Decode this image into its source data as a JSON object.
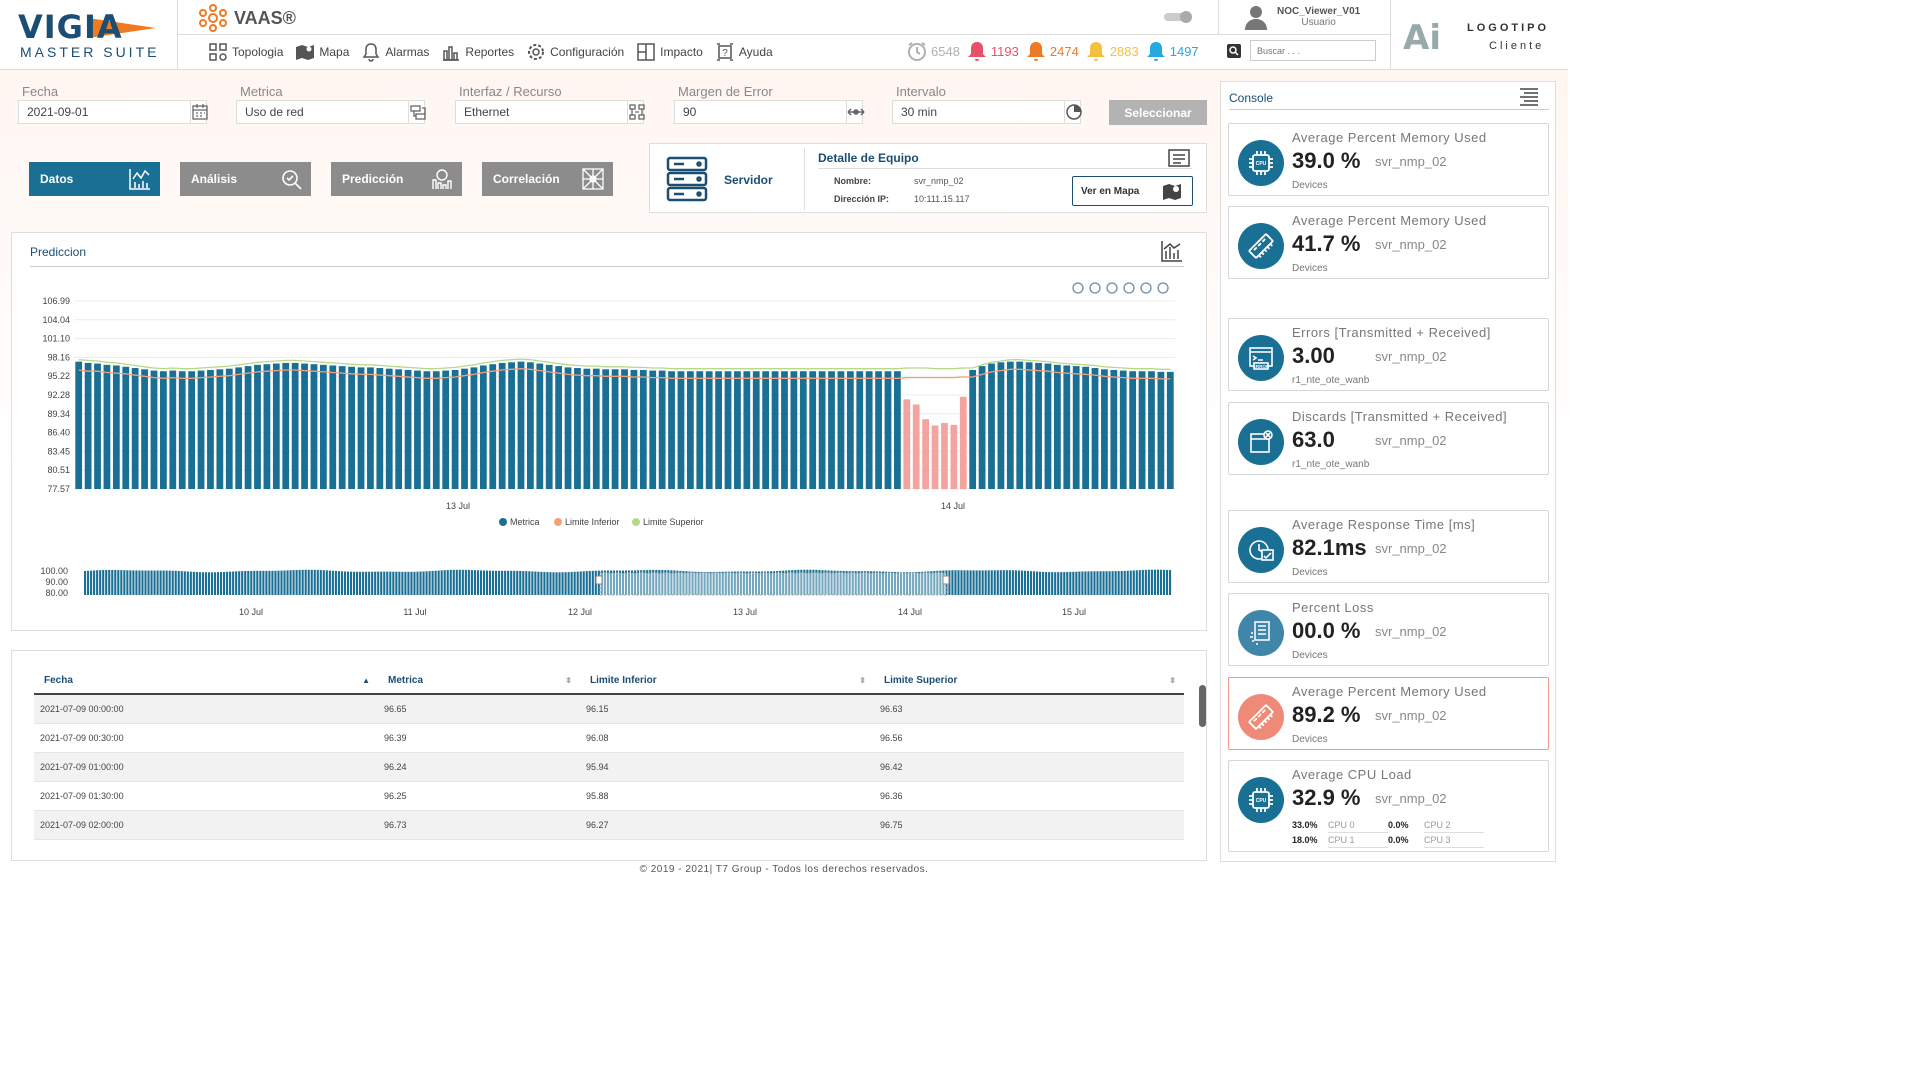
{
  "brand": {
    "main": "VIGIA",
    "sub": "MASTER SUITE",
    "product": "VAAS®"
  },
  "nav": [
    {
      "label": "Topologia",
      "icon": "topology-icon"
    },
    {
      "label": "Mapa",
      "icon": "map-icon"
    },
    {
      "label": "Alarmas",
      "icon": "bell-icon"
    },
    {
      "label": "Reportes",
      "icon": "reports-icon"
    },
    {
      "label": "Configuración",
      "icon": "gear-icon"
    },
    {
      "label": "Impacto",
      "icon": "impact-icon"
    },
    {
      "label": "Ayuda",
      "icon": "help-icon"
    }
  ],
  "user": {
    "name": "NOC_Viewer_V01",
    "role": "Usuario"
  },
  "counters": [
    {
      "value": "6548",
      "color": "#b0b0b0",
      "icon": "clock-icon"
    },
    {
      "value": "1193",
      "color": "#e8506a",
      "icon": "bell-critical-icon"
    },
    {
      "value": "2474",
      "color": "#f07a22",
      "icon": "bell-major-icon"
    },
    {
      "value": "2883",
      "color": "#f5c040",
      "icon": "bell-minor-icon"
    },
    {
      "value": "1497",
      "color": "#26a9e0",
      "icon": "bell-info-icon"
    }
  ],
  "search": {
    "placeholder": "Buscar . . ."
  },
  "client": {
    "logo": "Ai",
    "line1": "LOGOTIPO",
    "line2": "Cliente"
  },
  "filters": {
    "fecha": {
      "label": "Fecha",
      "value": "2021-09-01"
    },
    "metrica": {
      "label": "Metrica",
      "value": "Uso de red"
    },
    "interfaz": {
      "label": "Interfaz / Recurso",
      "value": "Ethernet"
    },
    "margen": {
      "label": "Margen de Error",
      "value": "90"
    },
    "intervalo": {
      "label": "Intervalo",
      "value": "30 min"
    },
    "select_label": "Seleccionar"
  },
  "tabs": [
    {
      "label": "Datos",
      "color": "#1a6f94"
    },
    {
      "label": "Análisis",
      "color": "#8c8c8c"
    },
    {
      "label": "Predicción",
      "color": "#8c8c8c"
    },
    {
      "label": "Correlación",
      "color": "#8c8c8c"
    }
  ],
  "equipo": {
    "type": "Servidor",
    "title": "Detalle de Equipo",
    "nombre_label": "Nombre:",
    "nombre": "svr_nmp_02",
    "ip_label": "Dirección IP:",
    "ip": "10:111.15.117",
    "map_button": "Ver en Mapa"
  },
  "prediction": {
    "title": "Prediccion"
  },
  "chart_data": {
    "type": "bar",
    "yticks": [
      "106.99",
      "104.04",
      "101.10",
      "98.16",
      "95.22",
      "92.28",
      "89.34",
      "86.40",
      "83.45",
      "80.51",
      "77.57"
    ],
    "ylim": [
      77.57,
      106.99
    ],
    "xticks": [
      "13 Jul",
      "14 Jul"
    ],
    "legend": [
      "Metrica",
      "Limite Inferior",
      "Limite Superior"
    ],
    "legend_position": "bottom",
    "colors": {
      "metrica": "#1a6f94",
      "anomaly": "#f4a4a0",
      "inferior": "#f6a07a",
      "superior": "#b7d98a"
    },
    "series": [
      {
        "name": "Metrica",
        "values": [
          97.5,
          97.3,
          97.2,
          97.0,
          96.9,
          96.7,
          96.5,
          96.3,
          96.1,
          96.0,
          96.1,
          96.0,
          96.0,
          96.1,
          96.2,
          96.3,
          96.4,
          96.6,
          96.8,
          97.0,
          97.1,
          97.2,
          97.3,
          97.3,
          97.2,
          97.1,
          97.0,
          96.9,
          96.8,
          96.7,
          96.6,
          96.6,
          96.5,
          96.4,
          96.3,
          96.2,
          96.1,
          96.0,
          96.0,
          96.1,
          96.2,
          96.4,
          96.6,
          96.9,
          97.1,
          97.3,
          97.4,
          97.5,
          97.4,
          97.2,
          97.0,
          96.8,
          96.6,
          96.5,
          96.4,
          96.4,
          96.3,
          96.3,
          96.3,
          96.2,
          96.2,
          96.1,
          96.1,
          96.0,
          96.0,
          96.0,
          96.0,
          96.0,
          96.0,
          96.0,
          96.0,
          96.0,
          96.0,
          96.0,
          96.0,
          96.0,
          96.0,
          96.0,
          96.0,
          96.0,
          96.0,
          96.0,
          96.0,
          96.0,
          96.0,
          96.0,
          96.0,
          96.0,
          91.6,
          90.8,
          88.5,
          87.5,
          87.9,
          87.6,
          92.0,
          96.2,
          96.8,
          97.2,
          97.4,
          97.5,
          97.5,
          97.4,
          97.3,
          97.2,
          97.0,
          96.9,
          96.8,
          96.7,
          96.5,
          96.3,
          96.2,
          96.1,
          96.0,
          96.0,
          96.0,
          95.9,
          95.9
        ]
      },
      {
        "name": "Limite Inferior",
        "values": [
          96.2,
          96.0,
          96.0,
          95.8,
          95.7,
          95.6,
          95.4,
          95.2,
          95.0,
          94.9,
          95.0,
          94.9,
          94.9,
          95.0,
          95.1,
          95.2,
          95.3,
          95.5,
          95.7,
          95.9,
          96.0,
          96.1,
          96.2,
          96.2,
          96.1,
          96.0,
          95.9,
          95.8,
          95.7,
          95.6,
          95.5,
          95.5,
          95.4,
          95.3,
          95.2,
          95.1,
          95.0,
          94.9,
          94.9,
          95.0,
          95.1,
          95.3,
          95.5,
          95.8,
          96.0,
          96.2,
          96.3,
          96.4,
          96.3,
          96.1,
          95.9,
          95.7,
          95.5,
          95.4,
          95.3,
          95.3,
          95.2,
          95.2,
          95.2,
          95.1,
          95.1,
          95.0,
          95.0,
          94.9,
          94.9,
          94.9,
          94.9,
          94.9,
          94.9,
          94.9,
          94.9,
          94.9,
          94.9,
          94.9,
          94.9,
          94.9,
          94.9,
          94.9,
          94.9,
          94.9,
          94.9,
          94.9,
          94.9,
          94.9,
          94.9,
          94.9,
          94.9,
          94.9,
          95.0,
          95.0,
          95.0,
          95.0,
          95.0,
          95.0,
          95.1,
          95.1,
          95.5,
          95.9,
          96.1,
          96.3,
          96.3,
          96.2,
          96.1,
          96.0,
          95.8,
          95.7,
          95.6,
          95.5,
          95.4,
          95.2,
          95.1,
          95.0,
          94.9,
          94.9,
          94.9,
          94.8,
          94.8
        ]
      },
      {
        "name": "Limite Superior",
        "values": [
          97.8,
          97.7,
          97.6,
          97.4,
          97.3,
          97.1,
          96.9,
          96.7,
          96.5,
          96.4,
          96.5,
          96.4,
          96.4,
          96.5,
          96.6,
          96.7,
          96.8,
          97.0,
          97.2,
          97.4,
          97.5,
          97.6,
          97.7,
          97.7,
          97.6,
          97.5,
          97.4,
          97.3,
          97.2,
          97.1,
          97.0,
          97.0,
          96.9,
          96.8,
          96.7,
          96.6,
          96.5,
          96.4,
          96.4,
          96.5,
          96.6,
          96.8,
          97.0,
          97.3,
          97.5,
          97.7,
          97.8,
          97.9,
          97.8,
          97.6,
          97.4,
          97.2,
          97.0,
          96.9,
          96.8,
          96.8,
          96.7,
          96.7,
          96.7,
          96.6,
          96.6,
          96.5,
          96.5,
          96.4,
          96.4,
          96.4,
          96.4,
          96.4,
          96.4,
          96.4,
          96.4,
          96.4,
          96.4,
          96.4,
          96.4,
          96.4,
          96.4,
          96.4,
          96.4,
          96.4,
          96.4,
          96.4,
          96.4,
          96.4,
          96.4,
          96.4,
          96.4,
          96.4,
          96.5,
          96.5,
          96.5,
          96.4,
          96.4,
          96.4,
          96.5,
          96.5,
          97.0,
          97.4,
          97.6,
          97.8,
          97.8,
          97.7,
          97.6,
          97.5,
          97.3,
          97.2,
          97.1,
          97.0,
          96.9,
          96.7,
          96.6,
          96.5,
          96.4,
          96.4,
          96.4,
          96.3,
          96.3
        ]
      }
    ],
    "navigator": {
      "yticks": [
        "100.00",
        "90.00",
        "80.00"
      ],
      "ylim": [
        76,
        101
      ],
      "xticks": [
        "10 Jul",
        "11 Jul",
        "12 Jul",
        "13 Jul",
        "14 Jul",
        "15 Jul"
      ]
    }
  },
  "table": {
    "columns": [
      "Fecha",
      "Metrica",
      "Limite Inferior",
      "Limite Superior"
    ],
    "rows": [
      [
        "2021-07-09 00:00:00",
        "96.65",
        "96.15",
        "96.63"
      ],
      [
        "2021-07-09 00:30:00",
        "96.39",
        "96.08",
        "96.56"
      ],
      [
        "2021-07-09 01:00:00",
        "96.24",
        "95.94",
        "96.42"
      ],
      [
        "2021-07-09 01:30:00",
        "96.25",
        "95.88",
        "96.36"
      ],
      [
        "2021-07-09 02:00:00",
        "96.73",
        "96.27",
        "96.75"
      ]
    ]
  },
  "console": {
    "title": "Console",
    "cards": [
      {
        "title": "Average Percent Memory Used",
        "value": "39.0 %",
        "device": "svr_nmp_02",
        "sub": "Devices",
        "icon": "cpu-icon",
        "alert": false
      },
      {
        "title": "Average Percent Memory Used",
        "value": "41.7 %",
        "device": "svr_nmp_02",
        "sub": "Devices",
        "icon": "memory-icon",
        "alert": false
      },
      {
        "title": "Errors [Transmitted + Received]",
        "value": "3.00",
        "device": "svr_nmp_02",
        "sub": "r1_nte_ote_wanb",
        "icon": "error-icon",
        "alert": false
      },
      {
        "title": "Discards [Transmitted + Received]",
        "value": "63.0",
        "device": "svr_nmp_02",
        "sub": "r1_nte_ote_wanb",
        "icon": "discard-icon",
        "alert": false
      },
      {
        "title": "Average Response Time [ms]",
        "value": "82.1ms",
        "device": "svr_nmp_02",
        "sub": "Devices",
        "icon": "response-time-icon",
        "alert": false
      },
      {
        "title": "Percent Loss",
        "value": "00.0 %",
        "device": "svr_nmp_02",
        "sub": "Devices",
        "icon": "packet-loss-icon",
        "alert": false
      },
      {
        "title": "Average Percent Memory Used",
        "value": "89.2 %",
        "device": "svr_nmp_02",
        "sub": "Devices",
        "icon": "memory-icon",
        "alert": true
      },
      {
        "title": "Average CPU Load",
        "value": "32.9 %",
        "device": "svr_nmp_02",
        "icon": "cpu-icon",
        "alert": false,
        "cpus": [
          {
            "value": "33.0%",
            "label": "CPU 0"
          },
          {
            "value": "0.0%",
            "label": "CPU 2"
          },
          {
            "value": "18.0%",
            "label": "CPU 1"
          },
          {
            "value": "0.0%",
            "label": "CPU 3"
          }
        ]
      }
    ]
  },
  "footer": "© 2019 - 2021| T7 Group - Todos los derechos reservados."
}
